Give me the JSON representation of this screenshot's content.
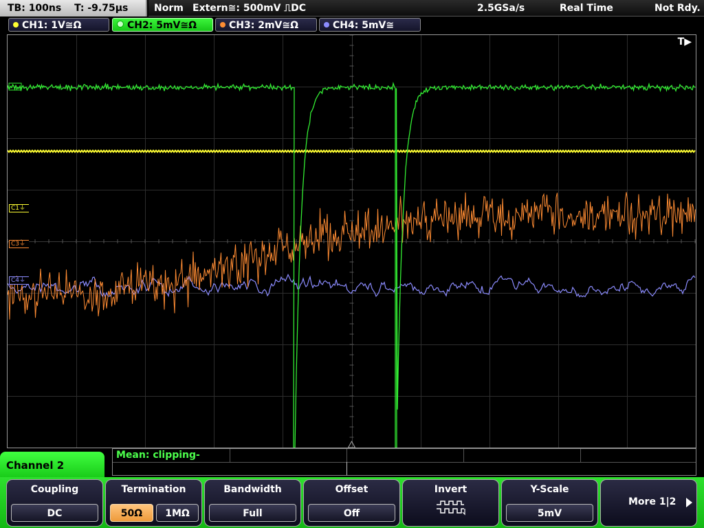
{
  "top": {
    "timebase": "TB: 100ns",
    "trigger_time": "T: -9.75µs",
    "mode": "Norm",
    "trigger_source": "Extern≅: 500mV ⎍DC",
    "sample_rate": "2.5GSa/s",
    "acq_mode": "Real Time",
    "status": "Not Rdy."
  },
  "channels": [
    {
      "label": "CH1: 1V≅Ω",
      "color": "#ffff33"
    },
    {
      "label": "CH2: 5mV≅Ω",
      "color": "#33ee33"
    },
    {
      "label": "CH3: 2mV≅Ω",
      "color": "#ff8c33"
    },
    {
      "label": "CH4: 5mV≅",
      "color": "#8c8cff"
    }
  ],
  "trigger_indicator": "T▶",
  "markers": {
    "c1": "C1⏚",
    "c3": "C3⏚",
    "c4": "C4⏚"
  },
  "measurement": {
    "text": "Mean: clipping-"
  },
  "menu": {
    "title": "Channel 2",
    "coupling": {
      "title": "Coupling",
      "value": "DC"
    },
    "termination": {
      "title": "Termination",
      "opt1": "50Ω",
      "opt2": "1MΩ"
    },
    "bandwidth": {
      "title": "Bandwidth",
      "value": "Full"
    },
    "offset": {
      "title": "Offset",
      "value": "Off"
    },
    "invert": {
      "title": "Invert",
      "icon": "inverted-square-wave-icon"
    },
    "yscale": {
      "title": "Y-Scale",
      "value": "5mV"
    },
    "more": {
      "label": "More 1|2"
    }
  }
}
